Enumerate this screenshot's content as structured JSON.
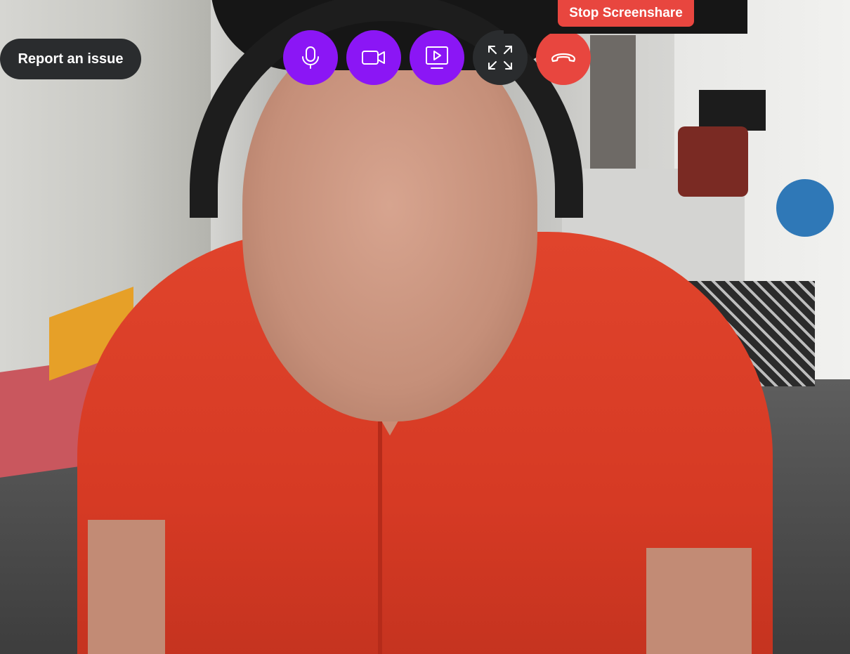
{
  "colors": {
    "purple": "#8b16f5",
    "dark": "#2a2c2e",
    "danger": "#e8463f"
  },
  "report_issue": {
    "label": "Report an issue"
  },
  "screenshare": {
    "stop_label": "Stop Screenshare"
  },
  "controls": [
    {
      "name": "microphone",
      "icon": "microphone-icon",
      "color": "#8b16f5"
    },
    {
      "name": "camera",
      "icon": "video-camera-icon",
      "color": "#8b16f5"
    },
    {
      "name": "screenshare",
      "icon": "screen-share-icon",
      "color": "#8b16f5"
    },
    {
      "name": "fullscreen",
      "icon": "expand-icon",
      "color": "#2a2c2e"
    },
    {
      "name": "hang-up",
      "icon": "phone-hangup-icon",
      "color": "#e8463f"
    }
  ]
}
